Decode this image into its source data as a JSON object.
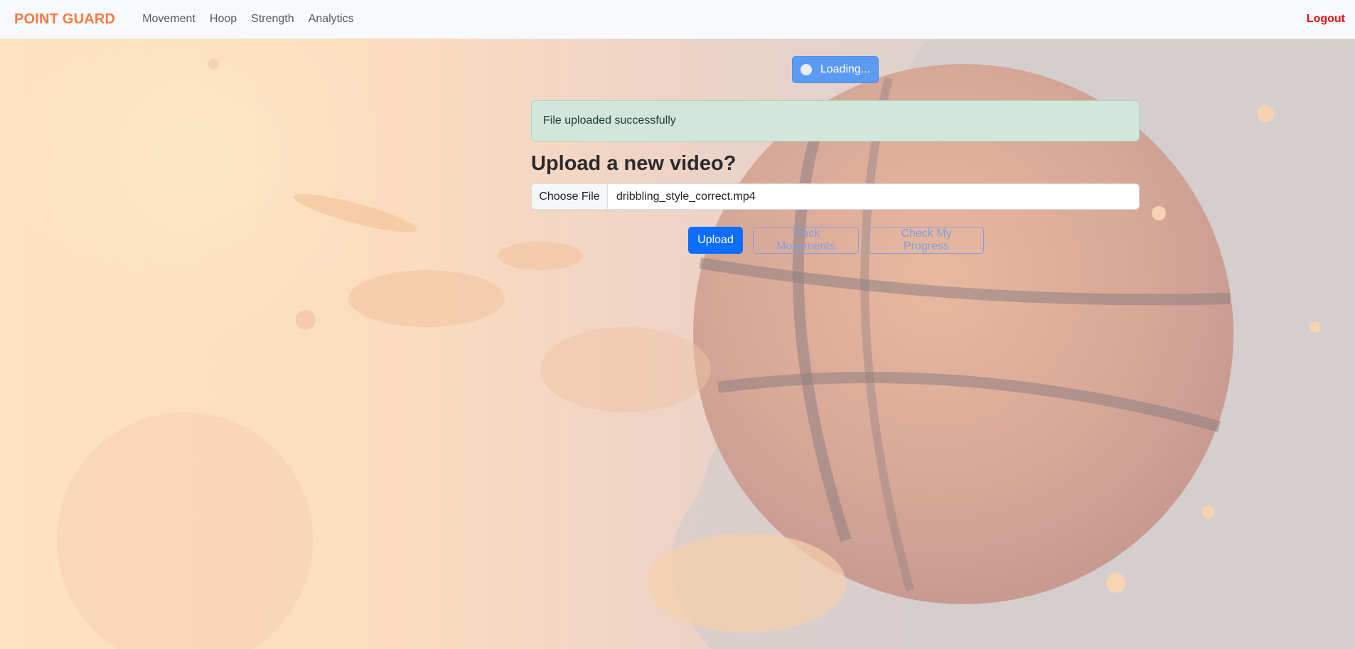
{
  "navbar": {
    "brand": "POINT GUARD",
    "links": [
      "Movement",
      "Hoop",
      "Strength",
      "Analytics"
    ],
    "logout": "Logout"
  },
  "loading": {
    "label": "Loading..."
  },
  "alert": {
    "message": "File uploaded successfully"
  },
  "upload": {
    "title": "Upload a new video?",
    "choose_label": "Choose File",
    "file_name": "dribbling_style_correct.mp4"
  },
  "actions": {
    "upload": "Upload",
    "track": "Track Movements",
    "progress": "Check My Progress"
  },
  "colors": {
    "brand": "#f47a42",
    "logout": "#e01010",
    "primary": "#0d6efd",
    "alert_bg": "#d1e7dd"
  }
}
